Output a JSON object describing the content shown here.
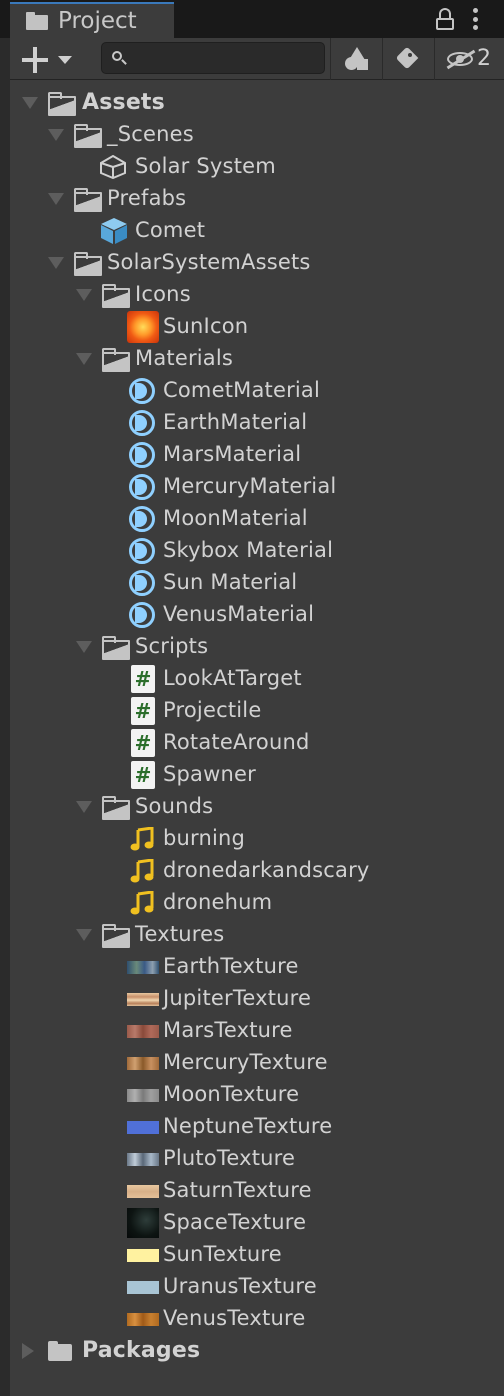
{
  "tab": {
    "title": "Project"
  },
  "toolbar": {
    "search_placeholder": "",
    "hidden_count": "2"
  },
  "tree": {
    "assets": "Assets",
    "scenes": "_Scenes",
    "solar_system": "Solar System",
    "prefabs": "Prefabs",
    "comet": "Comet",
    "solar_system_assets": "SolarSystemAssets",
    "icons": "Icons",
    "sun_icon": "SunIcon",
    "materials": "Materials",
    "material_items": [
      "CometMaterial",
      "EarthMaterial",
      "MarsMaterial",
      "MercuryMaterial",
      "MoonMaterial",
      "Skybox Material",
      "Sun Material",
      "VenusMaterial"
    ],
    "scripts": "Scripts",
    "script_items": [
      "LookAtTarget",
      "Projectile",
      "RotateAround",
      "Spawner"
    ],
    "sounds": "Sounds",
    "sound_items": [
      "burning",
      "dronedarkandscary",
      "dronehum"
    ],
    "textures": "Textures",
    "texture_items": [
      "EarthTexture",
      "JupiterTexture",
      "MarsTexture",
      "MercuryTexture",
      "MoonTexture",
      "NeptuneTexture",
      "PlutoTexture",
      "SaturnTexture",
      "SpaceTexture",
      "SunTexture",
      "UranusTexture",
      "VenusTexture"
    ],
    "packages": "Packages"
  },
  "colors": {
    "material_icon": "#8fd0ff",
    "audio_icon": "#f0c020",
    "script_hash": "#2b6e2b",
    "texture_earth": "#4a6a8a",
    "texture_jupiter": "#d8b08a",
    "texture_mars": "#a86a5a",
    "texture_mercury": "#b08050",
    "texture_moon": "#9a9a9a",
    "texture_neptune": "#5070d8",
    "texture_pluto": "#8a98a8",
    "texture_saturn": "#e0bc92",
    "texture_sun": "#fff2a0",
    "texture_uranus": "#a8c4d4",
    "texture_venus": "#c07a30"
  }
}
